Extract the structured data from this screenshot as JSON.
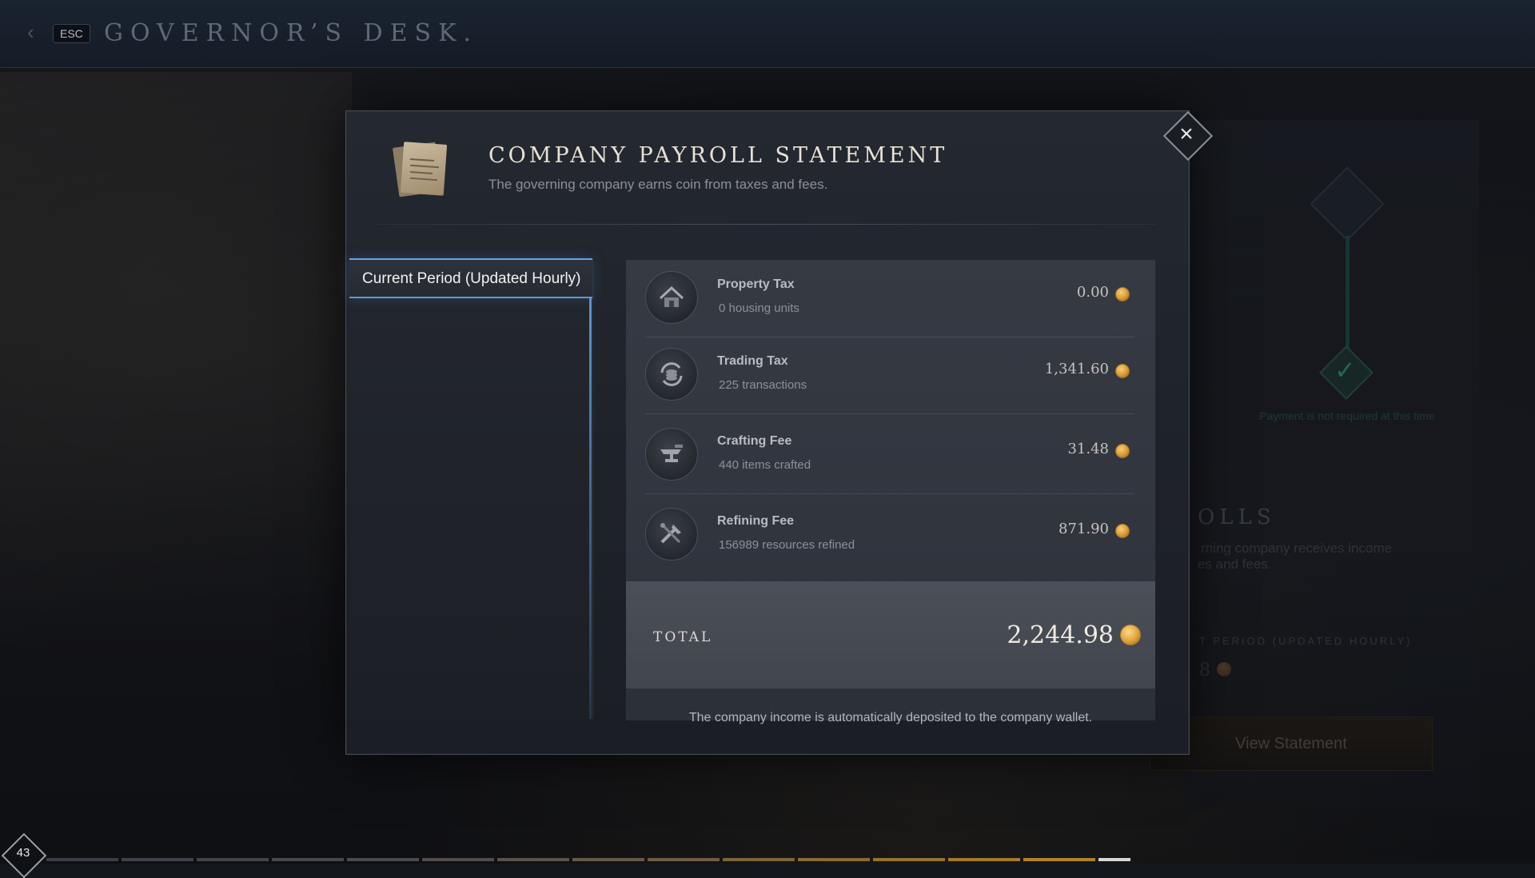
{
  "topbar": {
    "esc_label": "ESC",
    "title": "GOVERNOR’S DESK."
  },
  "background_panel": {
    "payment_message": "Payment is not required at this time",
    "section_title": "OLLS",
    "description_line1": "rning company receives income",
    "description_line2": "es and fees.",
    "period_label": "T PERIOD (UPDATED HOURLY)",
    "amount_fragment": "8",
    "button_label": "View Statement"
  },
  "modal": {
    "title": "COMPANY PAYROLL STATEMENT",
    "subtitle": "The governing company earns coin from taxes and fees.",
    "close_icon": "close-icon",
    "tabs": [
      {
        "label": "Current Period (Updated Hourly)",
        "active": true
      }
    ],
    "rows": [
      {
        "icon": "house-icon",
        "name": "Property Tax",
        "detail": "0 housing units",
        "amount": "0.00"
      },
      {
        "icon": "exchange-icon",
        "name": "Trading Tax",
        "detail": "225 transactions",
        "amount": "1,341.60"
      },
      {
        "icon": "anvil-icon",
        "name": "Crafting Fee",
        "detail": "440 items crafted",
        "amount": "31.48"
      },
      {
        "icon": "tools-icon",
        "name": "Refining Fee",
        "detail": "156989 resources refined",
        "amount": "871.90"
      }
    ],
    "total": {
      "label": "TOTAL",
      "amount": "2,244.98"
    },
    "footer_note": "The company income is automatically deposited to the company wallet."
  },
  "bottom": {
    "level": "43"
  },
  "colors": {
    "accent_blue": "#6aa2dc",
    "coin_gold": "#e1a23c",
    "check_green": "#3bb08c"
  }
}
